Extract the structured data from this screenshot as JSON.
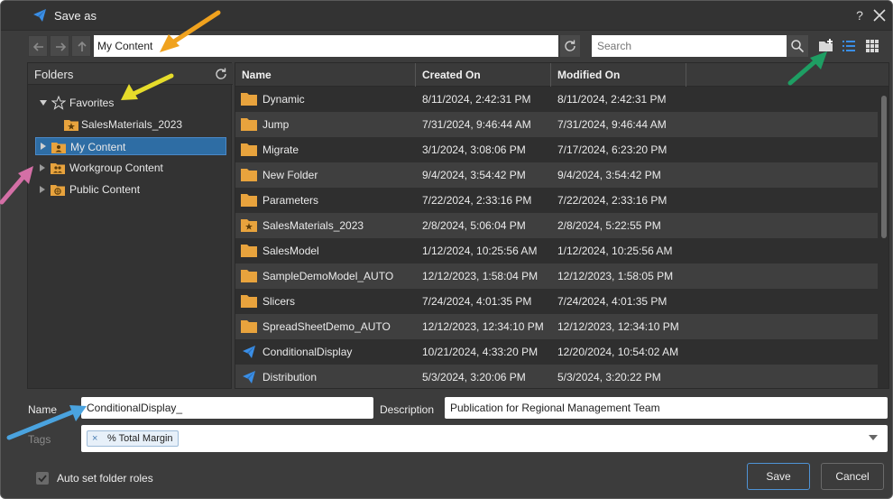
{
  "window": {
    "title": "Save as",
    "help_label": "?",
    "accent": "#3a8ee6"
  },
  "toolbar": {
    "path": "My Content",
    "search_placeholder": "Search"
  },
  "folders": {
    "header": "Folders",
    "items": [
      {
        "label": "Favorites",
        "icon": "star-icon",
        "expanded": true
      },
      {
        "label": "SalesMaterials_2023",
        "icon": "favorite-folder-icon"
      },
      {
        "label": "My Content",
        "icon": "user-folder-icon",
        "selected": true
      },
      {
        "label": "Workgroup Content",
        "icon": "group-folder-icon"
      },
      {
        "label": "Public Content",
        "icon": "globe-folder-icon"
      }
    ]
  },
  "files": {
    "columns": [
      "Name",
      "Created On",
      "Modified On"
    ],
    "rows": [
      {
        "name": "Dynamic",
        "created": "8/11/2024, 2:42:31 PM",
        "modified": "8/11/2024, 2:42:31 PM",
        "icon": "folder-icon"
      },
      {
        "name": "Jump",
        "created": "7/31/2024, 9:46:44 AM",
        "modified": "7/31/2024, 9:46:44 AM",
        "icon": "folder-icon"
      },
      {
        "name": "Migrate",
        "created": "3/1/2024, 3:08:06 PM",
        "modified": "7/17/2024, 6:23:20 PM",
        "icon": "folder-icon"
      },
      {
        "name": "New Folder",
        "created": "9/4/2024, 3:54:42 PM",
        "modified": "9/4/2024, 3:54:42 PM",
        "icon": "folder-icon"
      },
      {
        "name": "Parameters",
        "created": "7/22/2024, 2:33:16 PM",
        "modified": "7/22/2024, 2:33:16 PM",
        "icon": "folder-icon"
      },
      {
        "name": "SalesMaterials_2023",
        "created": "2/8/2024, 5:06:04 PM",
        "modified": "2/8/2024, 5:22:55 PM",
        "icon": "favorite-folder-icon"
      },
      {
        "name": "SalesModel",
        "created": "1/12/2024, 10:25:56 AM",
        "modified": "1/12/2024, 10:25:56 AM",
        "icon": "folder-icon"
      },
      {
        "name": "SampleDemoModel_AUTO",
        "created": "12/12/2023, 1:58:04 PM",
        "modified": "12/12/2023, 1:58:05 PM",
        "icon": "folder-icon"
      },
      {
        "name": "Slicers",
        "created": "7/24/2024, 4:01:35 PM",
        "modified": "7/24/2024, 4:01:35 PM",
        "icon": "folder-icon"
      },
      {
        "name": "SpreadSheetDemo_AUTO",
        "created": "12/12/2023, 12:34:10 PM",
        "modified": "12/12/2023, 12:34:10 PM",
        "icon": "folder-icon"
      },
      {
        "name": "ConditionalDisplay",
        "created": "10/21/2024, 4:33:20 PM",
        "modified": "12/20/2024, 10:54:02 AM",
        "icon": "publication-icon"
      },
      {
        "name": "Distribution",
        "created": "5/3/2024, 3:20:06 PM",
        "modified": "5/3/2024, 3:20:22 PM",
        "icon": "publication-icon"
      }
    ]
  },
  "form": {
    "name_label": "Name",
    "name_value": "ConditionalDisplay_",
    "description_label": "Description",
    "description_value": "Publication for Regional Management Team",
    "tags_label": "Tags",
    "tags": [
      "% Total Margin"
    ],
    "auto_roles_label": "Auto set folder roles",
    "auto_roles_checked": true
  },
  "buttons": {
    "save": "Save",
    "cancel": "Cancel"
  },
  "colors": {
    "folder": "#e8a33d",
    "annotation_orange": "#f0a21e",
    "annotation_yellow": "#e6dc2a",
    "annotation_green": "#1e9e63",
    "annotation_pink": "#d46fa6",
    "annotation_blue": "#4aa3df"
  }
}
